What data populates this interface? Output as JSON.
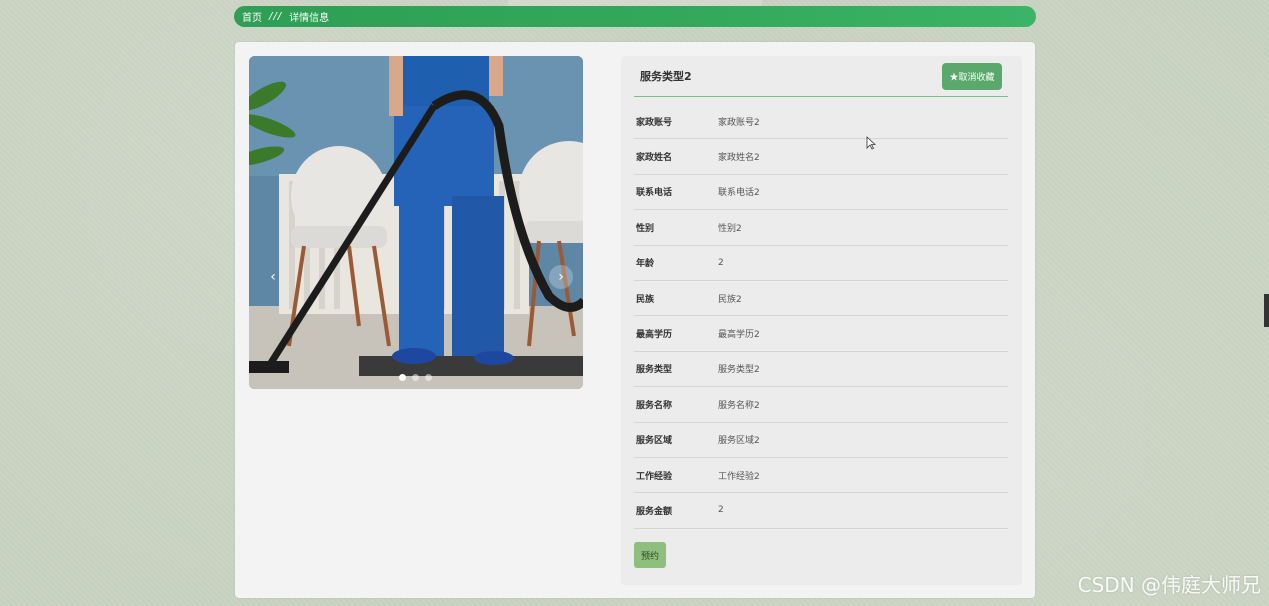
{
  "breadcrumb": {
    "home": "首页",
    "separator": "///",
    "current": "详情信息"
  },
  "carousel": {
    "prev_icon": "chevron-left-icon",
    "next_icon": "chevron-right-icon",
    "slide_count": 3,
    "active_slide": 1
  },
  "detail": {
    "title": "服务类型2",
    "favorite_label": "★取消收藏",
    "fields": [
      {
        "label": "家政账号",
        "value": "家政账号2"
      },
      {
        "label": "家政姓名",
        "value": "家政姓名2"
      },
      {
        "label": "联系电话",
        "value": "联系电话2"
      },
      {
        "label": "性别",
        "value": "性别2"
      },
      {
        "label": "年龄",
        "value": "2"
      },
      {
        "label": "民族",
        "value": "民族2"
      },
      {
        "label": "最高学历",
        "value": "最高学历2"
      },
      {
        "label": "服务类型",
        "value": "服务类型2"
      },
      {
        "label": "服务名称",
        "value": "服务名称2"
      },
      {
        "label": "服务区域",
        "value": "服务区域2"
      },
      {
        "label": "工作经验",
        "value": "工作经验2"
      },
      {
        "label": "服务金额",
        "value": "2"
      }
    ],
    "book_label": "预约"
  },
  "watermark": "CSDN @伟庭大师兄",
  "colors": {
    "accent_green": "#33a95c",
    "button_green": "#5aa86b",
    "book_button": "#8fbf7d",
    "page_bg": "#c9d3c1"
  }
}
